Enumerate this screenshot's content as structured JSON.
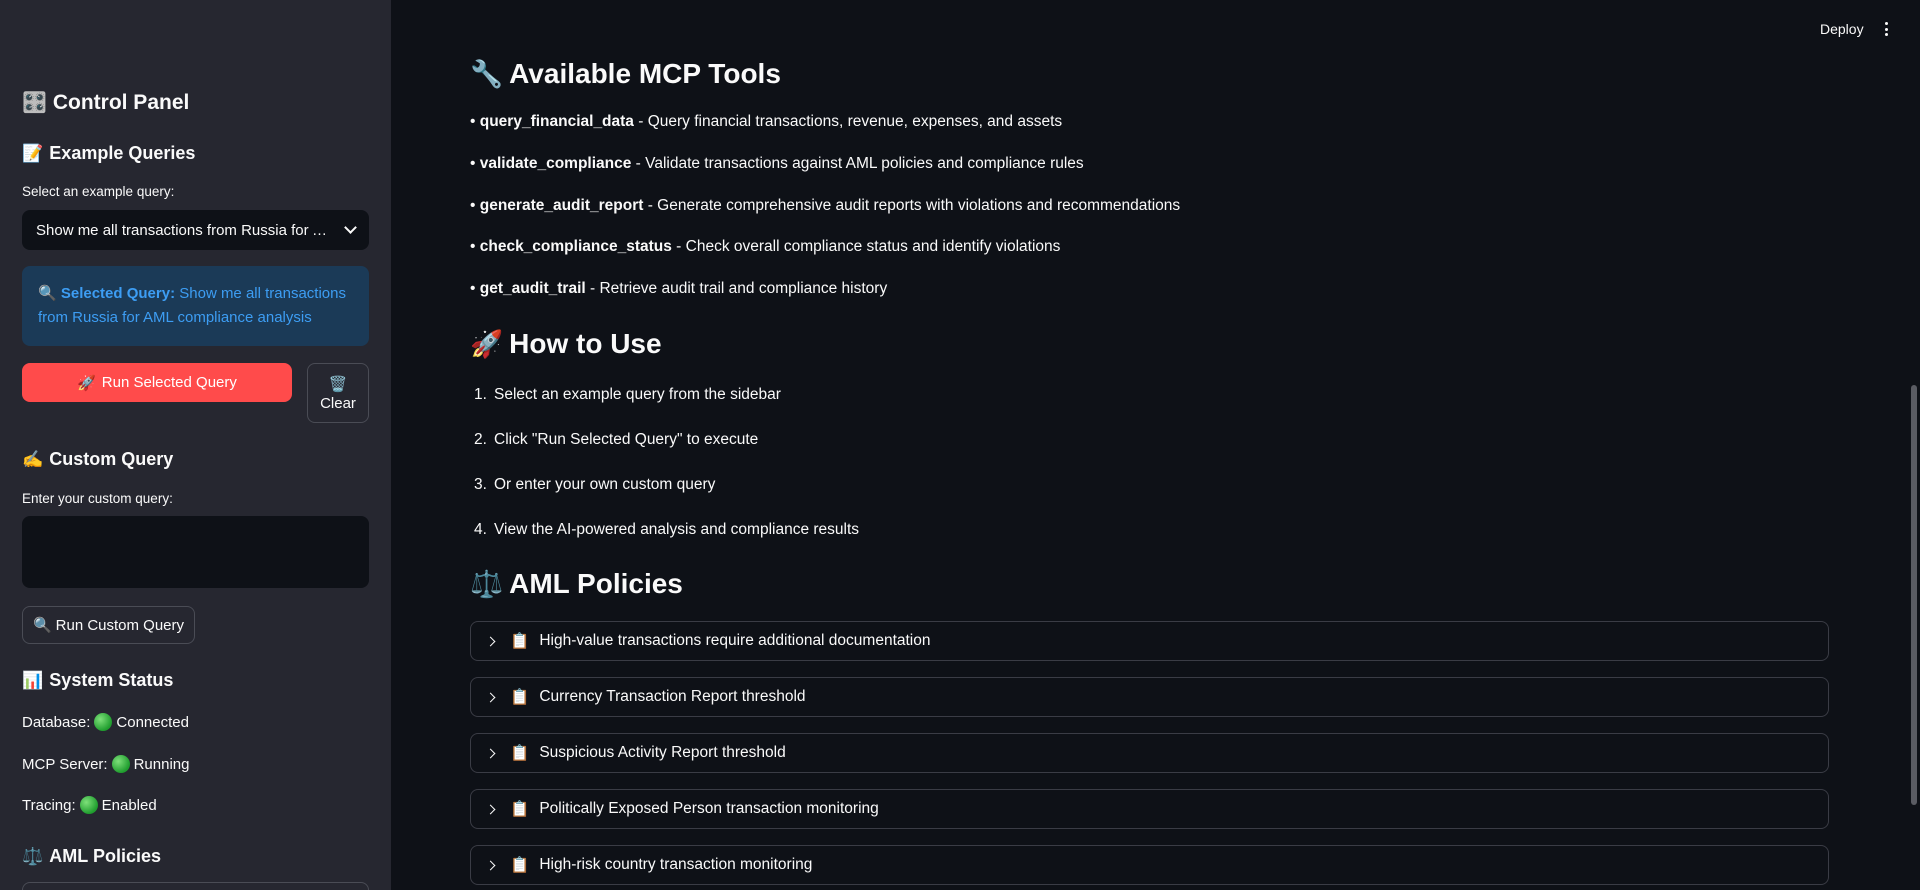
{
  "sidebar": {
    "control_panel": {
      "icon": "control-knobs-icon",
      "glyph": "🎛️",
      "title": "Control Panel"
    },
    "example_queries": {
      "icon": "memo-icon",
      "glyph": "📝",
      "title": "Example Queries"
    },
    "select_label": "Select an example query:",
    "select_value": "Show me all transactions from Russia for AML compliance analysis",
    "selected_info": {
      "glyph": "🔍",
      "label": "Selected Query:",
      "text": "Show me all transactions from Russia for AML compliance analysis"
    },
    "run_selected": {
      "glyph": "🚀",
      "label": "Run Selected Query"
    },
    "clear": {
      "glyph": "🗑️",
      "label": "Clear"
    },
    "custom_query": {
      "glyph": "✍️",
      "title": "Custom Query"
    },
    "custom_label": "Enter your custom query:",
    "custom_value": "",
    "run_custom": {
      "glyph": "🔍",
      "label": "Run Custom Query"
    },
    "system_status": {
      "glyph": "📊",
      "title": "System Status"
    },
    "status": [
      {
        "label": "Database:",
        "value": "Connected",
        "color": "#21c354"
      },
      {
        "label": "MCP Server:",
        "value": "Running",
        "color": "#21c354"
      },
      {
        "label": "Tracing:",
        "value": "Enabled",
        "color": "#21c354"
      }
    ],
    "aml_policies": {
      "glyph": "⚖️",
      "title": "AML Policies"
    }
  },
  "header": {
    "deploy": "Deploy"
  },
  "main": {
    "tools_title": {
      "glyph": "🔧",
      "text": "Available MCP Tools"
    },
    "tools": [
      {
        "name": "query_financial_data",
        "desc": " - Query financial transactions, revenue, expenses, and assets"
      },
      {
        "name": "validate_compliance",
        "desc": " - Validate transactions against AML policies and compliance rules"
      },
      {
        "name": "generate_audit_report",
        "desc": " - Generate comprehensive audit reports with violations and recommendations"
      },
      {
        "name": "check_compliance_status",
        "desc": " - Check overall compliance status and identify violations"
      },
      {
        "name": "get_audit_trail",
        "desc": " - Retrieve audit trail and compliance history"
      }
    ],
    "howto_title": {
      "glyph": "🚀",
      "text": "How to Use"
    },
    "steps": [
      {
        "n": "1.",
        "text": "Select an example query from the sidebar"
      },
      {
        "n": "2.",
        "text": "Click \"Run Selected Query\" to execute"
      },
      {
        "n": "3.",
        "text": "Or enter your own custom query"
      },
      {
        "n": "4.",
        "text": "View the AI-powered analysis and compliance results"
      }
    ],
    "policies_title": {
      "glyph": "⚖️",
      "text": "AML Policies"
    },
    "policies": [
      {
        "glyph": "📋",
        "text": "High-value transactions require additional documentation"
      },
      {
        "glyph": "📋",
        "text": "Currency Transaction Report threshold"
      },
      {
        "glyph": "📋",
        "text": "Suspicious Activity Report threshold"
      },
      {
        "glyph": "📋",
        "text": "Politically Exposed Person transaction monitoring"
      },
      {
        "glyph": "📋",
        "text": "High-risk country transaction monitoring"
      }
    ]
  },
  "colors": {
    "sidebar_bg": "#262730",
    "main_bg": "#0e1117",
    "primary": "#ff4b4b",
    "info_text": "#3d9df3",
    "info_bg": "#1b3a57"
  }
}
